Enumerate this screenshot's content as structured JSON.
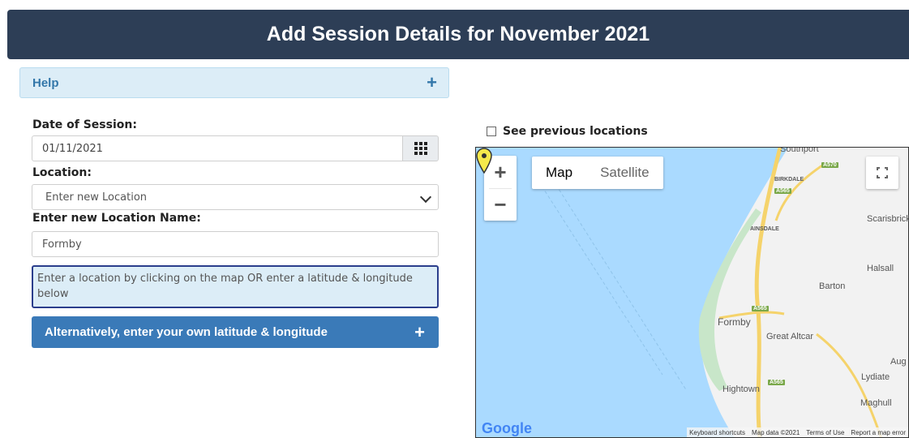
{
  "header": {
    "title": "Add Session Details for November 2021"
  },
  "help": {
    "label": "Help",
    "toggle": "+"
  },
  "form": {
    "date_label": "Date of Session:",
    "date_value": "01/11/2021",
    "location_label": "Location:",
    "location_selected": "Enter new Location",
    "new_location_label": "Enter new Location Name:",
    "new_location_value": "Formby",
    "info_text": "Enter a location by clicking on the map OR enter a latitude & longitude below",
    "alt_button": "Alternatively, enter your own latitude & longitude",
    "alt_toggle": "+"
  },
  "map_panel": {
    "see_previous_label": "See previous locations",
    "zoom_in": "+",
    "zoom_out": "−",
    "map_type_map": "Map",
    "map_type_satellite": "Satellite",
    "google_logo": "Google",
    "footer": [
      "Keyboard shortcuts",
      "Map data ©2021",
      "Terms of Use",
      "Report a map error"
    ],
    "places": [
      "Southport",
      "BIRKDALE",
      "AINSDALE",
      "Scarisbrick",
      "Halsall",
      "Barton",
      "Formby",
      "Great Altcar",
      "Aug",
      "Lydiate",
      "Hightown",
      "Maghull"
    ],
    "roads": [
      "A570",
      "A565",
      "A565",
      "A565"
    ],
    "colors": {
      "sea": "#aadaff",
      "land": "#f2f2f2",
      "park": "#c8e6c9",
      "road": "#f5d36b"
    },
    "marker_icon": "map-pin-icon"
  }
}
